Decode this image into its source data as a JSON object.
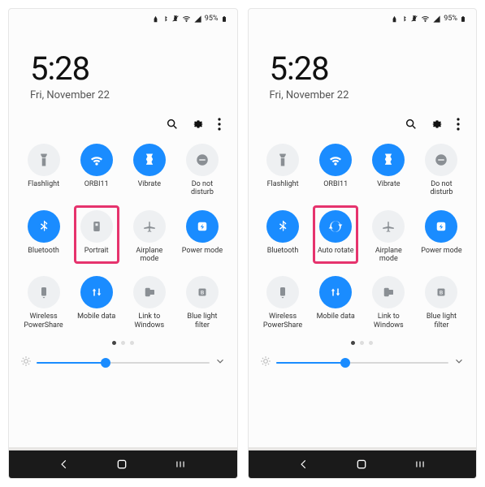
{
  "status": {
    "battery_pct": "95%"
  },
  "clock": {
    "time": "5:28",
    "date": "Fri, November 22"
  },
  "screens": [
    {
      "brightness_pct": 40,
      "highlight_index": 5,
      "tiles": [
        {
          "label": "Flashlight",
          "on": false,
          "icon": "flashlight"
        },
        {
          "label": "ORBI11",
          "on": true,
          "icon": "wifi"
        },
        {
          "label": "Vibrate",
          "on": true,
          "icon": "vibrate"
        },
        {
          "label": "Do not disturb",
          "on": false,
          "icon": "dnd"
        },
        {
          "label": "Bluetooth",
          "on": true,
          "icon": "bluetooth"
        },
        {
          "label": "Portrait",
          "on": false,
          "icon": "portrait"
        },
        {
          "label": "Airplane mode",
          "on": false,
          "icon": "airplane"
        },
        {
          "label": "Power mode",
          "on": true,
          "icon": "power"
        },
        {
          "label": "Wireless PowerShare",
          "on": false,
          "icon": "powershare"
        },
        {
          "label": "Mobile data",
          "on": true,
          "icon": "mobiledata"
        },
        {
          "label": "Link to Windows",
          "on": false,
          "icon": "link"
        },
        {
          "label": "Blue light filter",
          "on": false,
          "icon": "bluelight"
        }
      ]
    },
    {
      "brightness_pct": 40,
      "highlight_index": 5,
      "tiles": [
        {
          "label": "Flashlight",
          "on": false,
          "icon": "flashlight"
        },
        {
          "label": "ORBI11",
          "on": true,
          "icon": "wifi"
        },
        {
          "label": "Vibrate",
          "on": true,
          "icon": "vibrate"
        },
        {
          "label": "Do not disturb",
          "on": false,
          "icon": "dnd"
        },
        {
          "label": "Bluetooth",
          "on": true,
          "icon": "bluetooth"
        },
        {
          "label": "Auto rotate",
          "on": true,
          "icon": "autorotate"
        },
        {
          "label": "Airplane mode",
          "on": false,
          "icon": "airplane"
        },
        {
          "label": "Power mode",
          "on": true,
          "icon": "power"
        },
        {
          "label": "Wireless PowerShare",
          "on": false,
          "icon": "powershare"
        },
        {
          "label": "Mobile data",
          "on": true,
          "icon": "mobiledata"
        },
        {
          "label": "Link to Windows",
          "on": false,
          "icon": "link"
        },
        {
          "label": "Blue light filter",
          "on": false,
          "icon": "bluelight"
        }
      ]
    }
  ]
}
